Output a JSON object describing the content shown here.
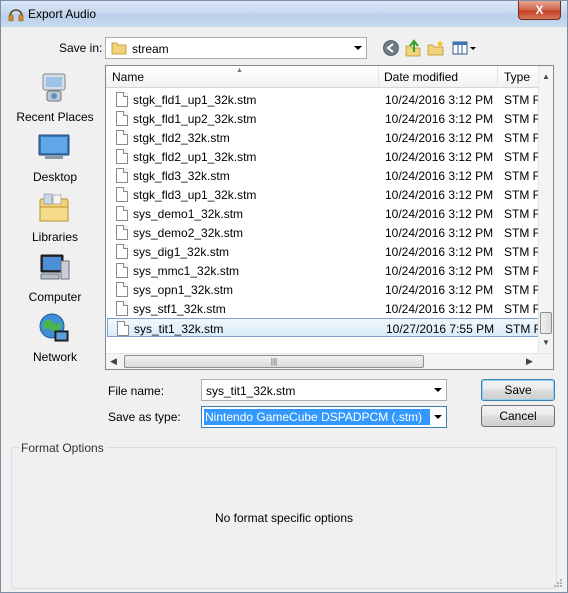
{
  "window": {
    "title": "Export Audio",
    "close_label": "X"
  },
  "save_in": {
    "label": "Save in:",
    "value": "stream"
  },
  "toolbar": [
    "back-icon",
    "up-folder-icon",
    "new-folder-icon",
    "view-menu-icon"
  ],
  "places": [
    {
      "label": "Recent Places",
      "icon": "recent-places-icon"
    },
    {
      "label": "Desktop",
      "icon": "desktop-icon"
    },
    {
      "label": "Libraries",
      "icon": "libraries-icon"
    },
    {
      "label": "Computer",
      "icon": "computer-icon"
    },
    {
      "label": "Network",
      "icon": "network-icon"
    }
  ],
  "file_list": {
    "columns": [
      "Name",
      "Date modified",
      "Type"
    ],
    "rows": [
      {
        "name": "stgk_fld1_up1_32k.stm",
        "date": "10/24/2016 3:12 PM",
        "type": "STM Fi"
      },
      {
        "name": "stgk_fld1_up2_32k.stm",
        "date": "10/24/2016 3:12 PM",
        "type": "STM Fi"
      },
      {
        "name": "stgk_fld2_32k.stm",
        "date": "10/24/2016 3:12 PM",
        "type": "STM Fi"
      },
      {
        "name": "stgk_fld2_up1_32k.stm",
        "date": "10/24/2016 3:12 PM",
        "type": "STM Fi"
      },
      {
        "name": "stgk_fld3_32k.stm",
        "date": "10/24/2016 3:12 PM",
        "type": "STM Fi"
      },
      {
        "name": "stgk_fld3_up1_32k.stm",
        "date": "10/24/2016 3:12 PM",
        "type": "STM Fi"
      },
      {
        "name": "sys_demo1_32k.stm",
        "date": "10/24/2016 3:12 PM",
        "type": "STM Fi"
      },
      {
        "name": "sys_demo2_32k.stm",
        "date": "10/24/2016 3:12 PM",
        "type": "STM Fi"
      },
      {
        "name": "sys_dig1_32k.stm",
        "date": "10/24/2016 3:12 PM",
        "type": "STM Fi"
      },
      {
        "name": "sys_mmc1_32k.stm",
        "date": "10/24/2016 3:12 PM",
        "type": "STM Fi"
      },
      {
        "name": "sys_opn1_32k.stm",
        "date": "10/24/2016 3:12 PM",
        "type": "STM Fi"
      },
      {
        "name": "sys_stf1_32k.stm",
        "date": "10/24/2016 3:12 PM",
        "type": "STM Fi"
      },
      {
        "name": "sys_tit1_32k.stm",
        "date": "10/27/2016 7:55 PM",
        "type": "STM Fi"
      }
    ],
    "selected_index": 12
  },
  "file_name": {
    "label": "File name:",
    "value": "sys_tit1_32k.stm"
  },
  "save_as_type": {
    "label": "Save as type:",
    "value": "Nintendo GameCube DSPADPCM (.stm)"
  },
  "buttons": {
    "save": "Save",
    "cancel": "Cancel"
  },
  "format_options": {
    "title": "Format Options",
    "message": "No format specific options"
  },
  "colors": {
    "selection": "#3399ff",
    "title_bar": "#c6d8ee",
    "close_button": "#c43f22"
  }
}
